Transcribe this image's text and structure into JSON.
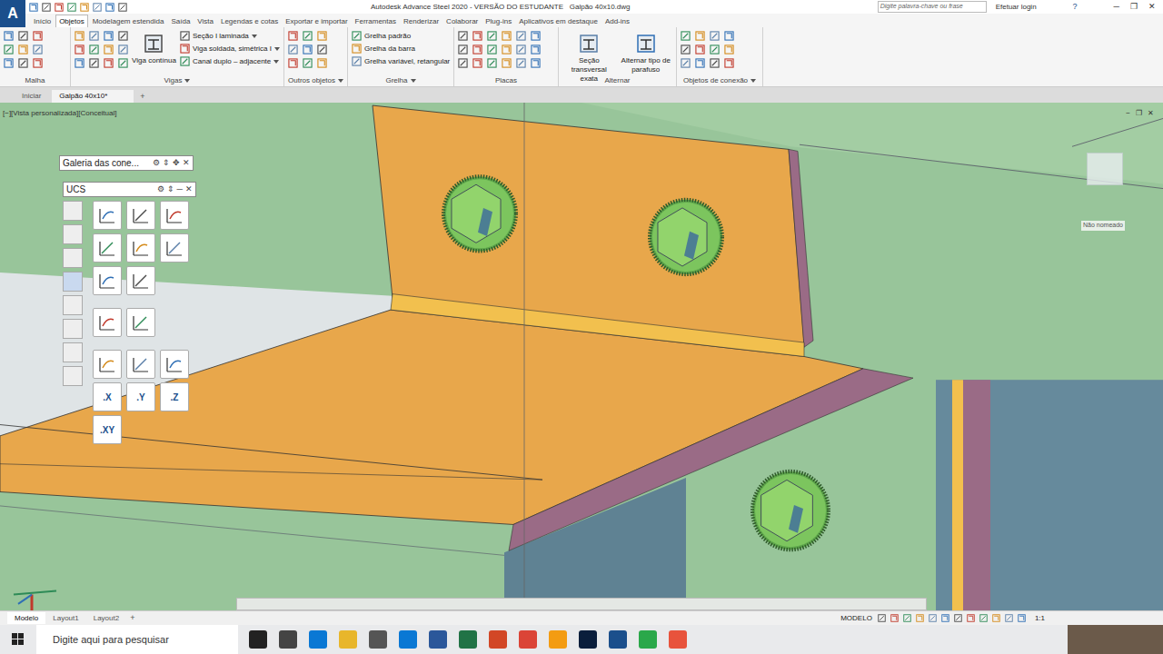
{
  "app_logo": "A",
  "window": {
    "title": "Autodesk Advance Steel 2020 - VERSÃO DO ESTUDANTE   Galpão 40x10.dwg",
    "controls": [
      "─",
      "❐",
      "✕"
    ]
  },
  "search": {
    "placeholder": "Digite palavra-chave ou frase"
  },
  "login": "Efetuar login",
  "help": "?",
  "ribbon_tabs": [
    {
      "label": "Início",
      "selected": false
    },
    {
      "label": "Objetos",
      "selected": true
    },
    {
      "label": "Modelagem estendida",
      "selected": false
    },
    {
      "label": "Saída",
      "selected": false
    },
    {
      "label": "Vista",
      "selected": false
    },
    {
      "label": "Legendas e cotas",
      "selected": false
    },
    {
      "label": "Exportar e importar",
      "selected": false
    },
    {
      "label": "Ferramentas",
      "selected": false
    },
    {
      "label": "Renderizar",
      "selected": false
    },
    {
      "label": "Colaborar",
      "selected": false
    },
    {
      "label": "Plug-ins",
      "selected": false
    },
    {
      "label": "Aplicativos em destaque",
      "selected": false
    },
    {
      "label": "Add-ins",
      "selected": false
    }
  ],
  "ribbon_groups": [
    {
      "label": "Malha",
      "dropdown": false,
      "large": [],
      "rows": []
    },
    {
      "label": "Vigas",
      "dropdown": true,
      "large": [
        "Viga contínua"
      ],
      "rows": [
        "Seção I laminada",
        "Viga soldada, simétrica I",
        "Canal duplo – adjacente"
      ]
    },
    {
      "label": "Outros objetos",
      "dropdown": true,
      "large": [],
      "rows": []
    },
    {
      "label": "Grelha",
      "dropdown": true,
      "large": [],
      "rows": [
        "Grelha padrão",
        "Grelha da barra",
        "Grelha variável, retangular"
      ]
    },
    {
      "label": "Placas",
      "dropdown": false,
      "large": [],
      "rows": []
    },
    {
      "label": "Alternar",
      "dropdown": false,
      "large": [
        "Seção transversal exata",
        "Alternar tipo de parafuso"
      ],
      "rows": []
    },
    {
      "label": "Objetos de conexão",
      "dropdown": true,
      "large": [],
      "rows": []
    }
  ],
  "doc_tabs": [
    {
      "label": "Iniciar",
      "selected": false
    },
    {
      "label": "Galpão 40x10*",
      "selected": true
    }
  ],
  "new_tab": "+",
  "viewport": {
    "label": "[−][Vista personalizada][Conceitual]",
    "view_name": "Não nomeado",
    "controls": [
      "−",
      "❐",
      "✕"
    ]
  },
  "palettes": [
    {
      "title": "Galeria das cone...",
      "controls": [
        "⚙",
        "⇕",
        "✥",
        "✕"
      ]
    },
    {
      "title": "UCS",
      "controls": [
        "⚙",
        "⇕",
        "─",
        "✕"
      ]
    }
  ],
  "ucs_axis_buttons": [
    ".X",
    ".Y",
    ".Z"
  ],
  "ucs_plane_button": ".XY",
  "layout_tabs": [
    {
      "label": "Modelo",
      "selected": true
    },
    {
      "label": "Layout1",
      "selected": false
    },
    {
      "label": "Layout2",
      "selected": false
    }
  ],
  "add_layout": "+",
  "status_bar": {
    "space": "MODELO",
    "scale": "1:1"
  },
  "taskbar": {
    "search_placeholder": "Digite aqui para pesquisar"
  }
}
